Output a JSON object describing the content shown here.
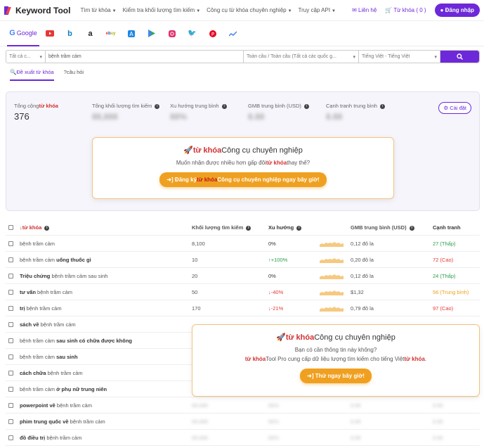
{
  "nav": {
    "logo": "Keyword Tool",
    "menu": [
      "Tìm từ khóa",
      "Kiểm tra khối lượng tìm kiếm",
      "Công cụ từ khóa chuyên nghiệp",
      "Truy cập API"
    ],
    "contact": "Liên hệ",
    "cart": "Từ khóa ( 0 )",
    "login": "Đăng nhập"
  },
  "engines": {
    "google": "Google",
    "list": [
      "youtube-icon",
      "bing-icon",
      "amazon-icon",
      "ebay-icon",
      "appstore-icon",
      "playstore-icon",
      "instagram-icon",
      "twitter-icon",
      "pinterest-icon",
      "trends-icon"
    ]
  },
  "search": {
    "type": "Tất cả c...",
    "query": "bệnh trầm cảm",
    "location": "Toàn cầu / Toàn cầu (Tất cả các quốc g...",
    "language": "Tiếng Việt - Tiếng Việt",
    "search_icon": "search-icon"
  },
  "subtabs": [
    "Đề xuất từ khóa",
    "câu hỏi"
  ],
  "summary": {
    "total_label_prefix": "Tổng cộng",
    "total_label_red": "từ khóa",
    "total_value": "376",
    "vol_label": "Tổng khối lượng tìm kiếm",
    "vol_value": "88,888",
    "trend_label": "Xu hướng trung bình",
    "trend_value": "88%",
    "gmb_label": "GMB trung bình (USD)",
    "gmb_value": "8.88",
    "comp_label": "Cạnh tranh trung bình",
    "comp_value": "8.88",
    "settings": "Cài đặt"
  },
  "promo1": {
    "title_red": "từ khóa",
    "title_rest": "Công cụ chuyên nghiệp",
    "sub_a": "Muốn nhận được nhiều hơn gấp đôi",
    "sub_red": "từ khóa",
    "sub_b": "thay thế?",
    "btn_a": "Đăng ký",
    "btn_red": "từ khóa",
    "btn_b": "Công cụ chuyên nghiệp ngay bây giờ!"
  },
  "promo2": {
    "title_red": "từ khóa",
    "title_rest": "Công cụ chuyên nghiệp",
    "line1": "Bạn có cần thông tin này không?",
    "line2_red_a": "từ khóa",
    "line2": "Tool Pro cung cấp dữ liệu lượng tìm kiếm cho tiếng Việt",
    "line2_red_b": "từ khóa",
    "line2_end": ".",
    "btn": "Thử ngay bây giờ!"
  },
  "table": {
    "headers": {
      "kw": "từ khóa",
      "vol": "Khối lượng tìm kiếm",
      "trend": "Xu hướng",
      "gmb": "GMB trung bình (USD)",
      "comp": "Cạnh tranh"
    },
    "rows": [
      {
        "pre": "",
        "bold": "",
        "post": "bệnh trầm cảm",
        "vol": "8,100",
        "trend": "0%",
        "trend_dir": "flat",
        "gmb": "0,12 đô la",
        "comp": "27 (Thấp)",
        "level": "low"
      },
      {
        "pre": "bệnh trầm cảm ",
        "bold": "uống thuốc gì",
        "post": "",
        "vol": "10",
        "trend": "↑+100%",
        "trend_dir": "up",
        "gmb": "0,20 đô la",
        "comp": "72 (Cao)",
        "level": "high"
      },
      {
        "pre": "",
        "bold": "Triệu chứng",
        "post": " bệnh trầm cảm sau sinh",
        "vol": "20",
        "trend": "0%",
        "trend_dir": "flat",
        "gmb": "0,12 đô la",
        "comp": "24 (Thấp)",
        "level": "low"
      },
      {
        "pre": "",
        "bold": "tư vấn",
        "post": " bệnh trầm cảm",
        "vol": "50",
        "trend": "↓-40%",
        "trend_dir": "down",
        "gmb": "$1,32",
        "comp": "56 (Trung bình)",
        "level": "mid"
      },
      {
        "pre": "",
        "bold": "trị",
        "post": " bệnh trầm cảm",
        "vol": "170",
        "trend": "↓-21%",
        "trend_dir": "down",
        "gmb": "0,79 đô la",
        "comp": "97 (Cao)",
        "level": "high"
      },
      {
        "pre": "",
        "bold": "sách về",
        "post": " bệnh trầm cảm",
        "vol": "",
        "trend": "",
        "trend_dir": "hidden",
        "gmb": "",
        "comp": "",
        "level": ""
      },
      {
        "pre": "bệnh trầm cảm ",
        "bold": "sau sinh có chữa được không",
        "post": "",
        "vol": "",
        "trend": "",
        "trend_dir": "hidden",
        "gmb": "",
        "comp": "",
        "level": ""
      },
      {
        "pre": "bệnh trầm cảm ",
        "bold": "sau sinh",
        "post": "",
        "vol": "",
        "trend": "",
        "trend_dir": "hidden",
        "gmb": "",
        "comp": "",
        "level": ""
      },
      {
        "pre": "",
        "bold": "cách chữa",
        "post": " bệnh trầm cảm",
        "vol": "",
        "trend": "",
        "trend_dir": "hidden",
        "gmb": "",
        "comp": "",
        "level": ""
      },
      {
        "pre": "bệnh trầm cảm ",
        "bold": "ở phụ nữ trung niên",
        "post": "",
        "vol": "",
        "trend": "",
        "trend_dir": "hidden",
        "gmb": "",
        "comp": "",
        "level": ""
      },
      {
        "pre": "",
        "bold": "powerpoint về",
        "post": " bệnh trầm cảm",
        "vol": "88,888",
        "trend": "88%",
        "trend_dir": "blur",
        "gmb": "8.88",
        "comp": "8.88",
        "level": "blur"
      },
      {
        "pre": "",
        "bold": "phim trung quốc về",
        "post": " bệnh trầm cảm",
        "vol": "88,888",
        "trend": "88%",
        "trend_dir": "blur",
        "gmb": "8.88",
        "comp": "8.88",
        "level": "blur"
      },
      {
        "pre": "",
        "bold": "đồ điều trị",
        "post": " bệnh trầm cảm",
        "vol": "88,888",
        "trend": "88%",
        "trend_dir": "blur",
        "gmb": "8.88",
        "comp": "8.88",
        "level": "blur"
      }
    ]
  },
  "colors": {
    "brand": "#6d28d9",
    "accent": "#f0a020",
    "red": "#d32f2f",
    "green": "#2e9d4d"
  }
}
